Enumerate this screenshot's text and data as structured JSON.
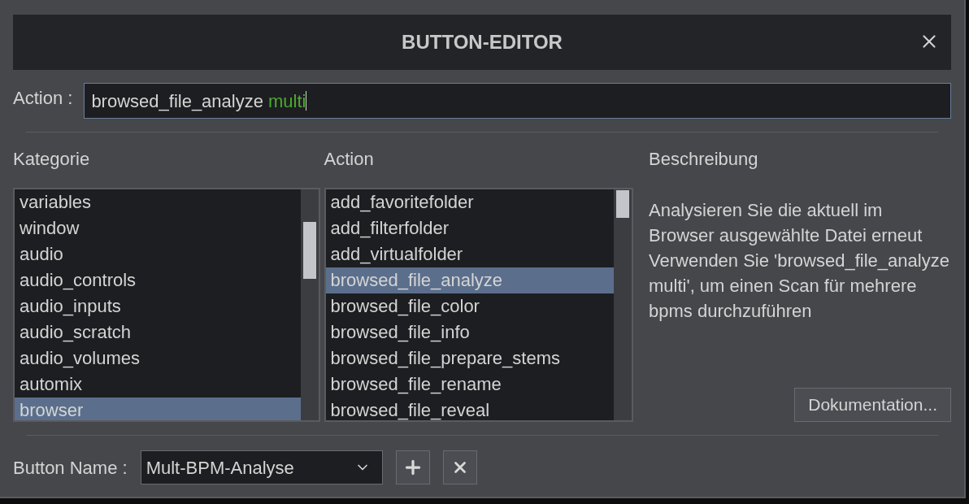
{
  "dialog": {
    "title": "BUTTON-EDITOR"
  },
  "action_field": {
    "label": "Action :",
    "value_parts": [
      {
        "text": "browsed_file_analyze",
        "kind": "command"
      },
      {
        "text": "multi",
        "kind": "argument"
      }
    ]
  },
  "category": {
    "heading": "Kategorie",
    "items": [
      {
        "label": "variables",
        "selected": false
      },
      {
        "label": "window",
        "selected": false
      },
      {
        "label": "audio",
        "selected": false
      },
      {
        "label": "audio_controls",
        "selected": false
      },
      {
        "label": "audio_inputs",
        "selected": false
      },
      {
        "label": "audio_scratch",
        "selected": false
      },
      {
        "label": "audio_volumes",
        "selected": false
      },
      {
        "label": "automix",
        "selected": false
      },
      {
        "label": "browser",
        "selected": true
      }
    ]
  },
  "action": {
    "heading": "Action",
    "items": [
      {
        "label": "add_favoritefolder",
        "selected": false
      },
      {
        "label": "add_filterfolder",
        "selected": false
      },
      {
        "label": "add_virtualfolder",
        "selected": false
      },
      {
        "label": "browsed_file_analyze",
        "selected": true
      },
      {
        "label": "browsed_file_color",
        "selected": false
      },
      {
        "label": "browsed_file_info",
        "selected": false
      },
      {
        "label": "browsed_file_prepare_stems",
        "selected": false
      },
      {
        "label": "browsed_file_rename",
        "selected": false
      },
      {
        "label": "browsed_file_reveal",
        "selected": false
      }
    ]
  },
  "description": {
    "heading": "Beschreibung",
    "paragraphs": [
      "Analysieren Sie die aktuell im Browser ausgewählte Datei erneut",
      "Verwenden Sie 'browsed_file_analyze multi', um einen Scan für mehrere bpms durchzuführen"
    ],
    "button": "Dokumentation..."
  },
  "button_name": {
    "label": "Button Name :",
    "value": "Mult-BPM-Analyse"
  }
}
